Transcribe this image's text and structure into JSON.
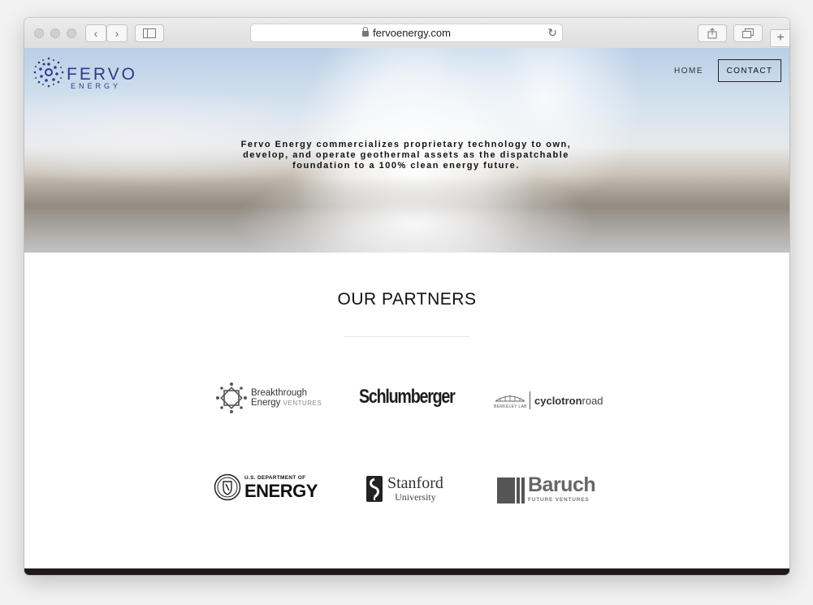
{
  "browser": {
    "url": "fervoenergy.com"
  },
  "site": {
    "logo_main": "FERVO",
    "logo_sub": "ENERGY",
    "nav": {
      "home": "HOME",
      "contact": "CONTACT"
    },
    "tagline": "Fervo Energy commercializes proprietary technology to own, develop, and operate geothermal assets as the dispatchable foundation to a 100% clean energy future.",
    "partners_title": "OUR PARTNERS",
    "partners": {
      "breakthrough": {
        "line1": "Breakthrough",
        "line2a": "Energy",
        "line2b": "VENTURES"
      },
      "schlumberger": {
        "name": "Schlumberger"
      },
      "cyclotron": {
        "lab": "BERKELEY LAB",
        "name_a": "cyclotron",
        "name_b": "road"
      },
      "doe": {
        "top": "U.S. DEPARTMENT OF",
        "main": "ENERGY"
      },
      "stanford": {
        "name": "Stanford",
        "sub": "University"
      },
      "baruch": {
        "name": "Baruch",
        "sub": "FUTURE VENTURES"
      }
    }
  },
  "colors": {
    "brand": "#2b3a8f",
    "footer": "#1f1a19"
  }
}
